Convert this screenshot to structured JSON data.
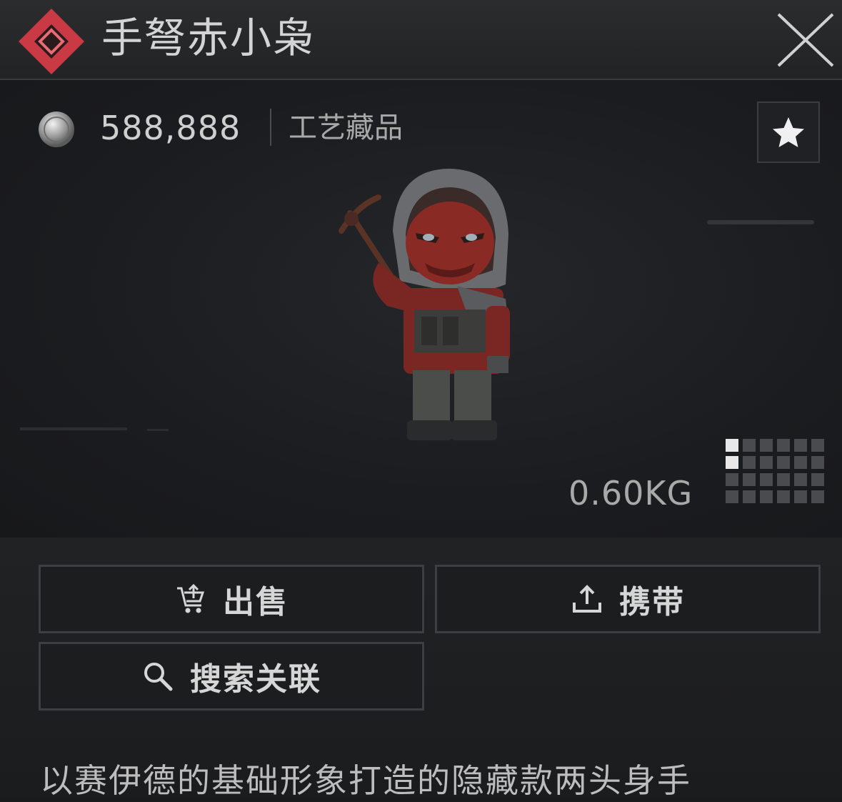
{
  "item": {
    "name": "手弩赤小枭",
    "price": "588,888",
    "category": "工艺藏品",
    "weight": "0.60KG",
    "rarity_color": "#d9424c",
    "size_grid": {
      "cols": 6,
      "rows": 4,
      "filled": [
        [
          0,
          0
        ],
        [
          0,
          1
        ]
      ]
    }
  },
  "actions": {
    "sell_label": "出售",
    "carry_label": "携带",
    "search_label": "搜索关联"
  },
  "description": "以赛伊德的基础形象打造的隐藏款两头身手",
  "icons": {
    "rarity": "diamond-rarity-icon",
    "close": "close-icon",
    "coin": "coin-icon",
    "favorite": "star-icon",
    "sell": "cart-icon",
    "carry": "upload-icon",
    "search": "search-icon",
    "grid": "item-size-grid-icon"
  }
}
